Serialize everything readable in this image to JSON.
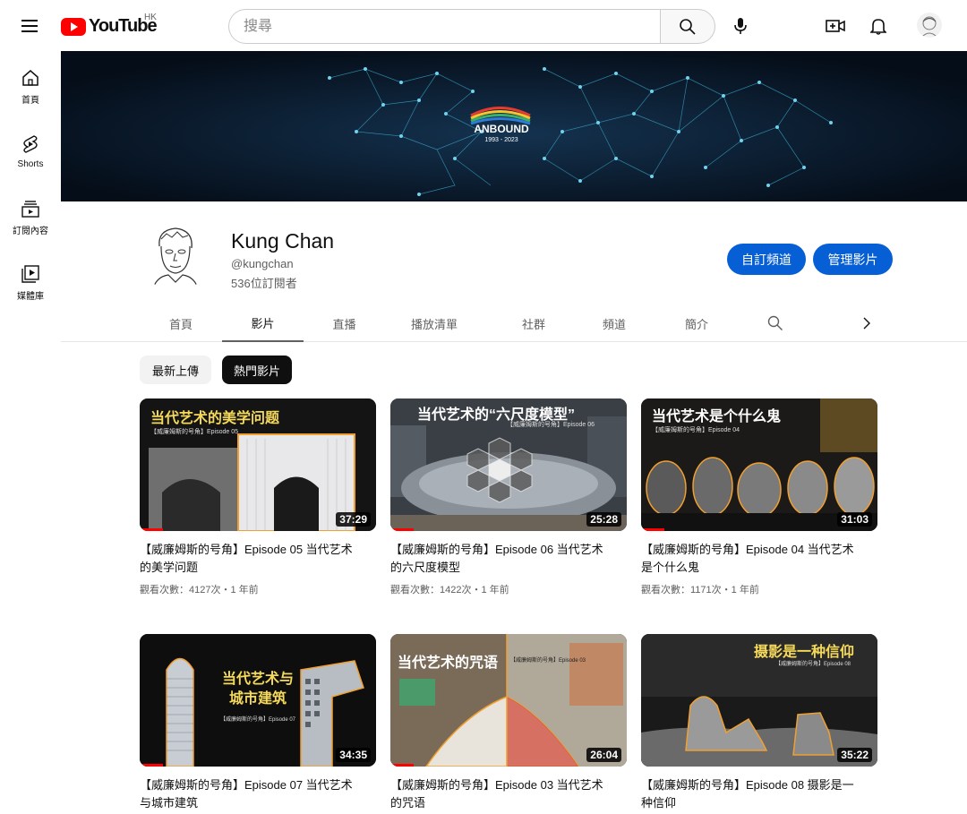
{
  "header": {
    "logo_text": "YouTube",
    "region": "HK",
    "search_placeholder": "搜尋"
  },
  "sidebar": {
    "items": [
      {
        "label": "首頁",
        "icon": "home-icon"
      },
      {
        "label": "Shorts",
        "icon": "shorts-icon"
      },
      {
        "label": "訂閱內容",
        "icon": "subscriptions-icon"
      },
      {
        "label": "媒體庫",
        "icon": "library-icon"
      }
    ]
  },
  "banner": {
    "logo_text": "ANBOUND",
    "years": "1993 - 2023"
  },
  "channel": {
    "name": "Kung Chan",
    "handle": "@kungchan",
    "subscribers": "536位訂閱者",
    "customize_label": "自訂頻道",
    "manage_label": "管理影片"
  },
  "tabs": [
    "首頁",
    "影片",
    "直播",
    "播放清單",
    "社群",
    "頻道",
    "簡介"
  ],
  "active_tab": "影片",
  "chips": [
    "最新上傳",
    "熱門影片"
  ],
  "active_chip": "熱門影片",
  "videos": [
    {
      "thumb_text": "当代艺术的美学问题",
      "thumb_sub": "【威廉姆斯的号角】Episode 05",
      "duration": "37:29",
      "title": "【威廉姆斯的号角】Episode 05 当代艺术的美学问题",
      "meta": "觀看次數：4127次・1 年前",
      "progress": 0.1
    },
    {
      "thumb_text": "当代艺术的“六尺度模型”",
      "thumb_sub": "【威廉姆斯的号角】Episode 06",
      "duration": "25:28",
      "title": "【威廉姆斯的号角】Episode 06 当代艺术的六尺度模型",
      "meta": "觀看次數：1422次・1 年前",
      "progress": 0.1
    },
    {
      "thumb_text": "当代艺术是个什么鬼",
      "thumb_sub": "【威廉姆斯的号角】Episode 04",
      "duration": "31:03",
      "title": "【威廉姆斯的号角】Episode 04 当代艺术是个什么鬼",
      "meta": "觀看次數：1171次・1 年前",
      "progress": 0.1
    },
    {
      "thumb_text": "当代艺术与城市建筑",
      "thumb_sub": "【威廉姆斯的号角】Episode 07",
      "duration": "34:35",
      "title": "【威廉姆斯的号角】Episode 07 当代艺术与城市建筑",
      "meta": "",
      "progress": 0.1
    },
    {
      "thumb_text": "当代艺术的咒语",
      "thumb_sub": "【威廉姆斯的号角】Episode 03",
      "duration": "26:04",
      "title": "【威廉姆斯的号角】Episode 03 当代艺术的咒语",
      "meta": "",
      "progress": 0.1
    },
    {
      "thumb_text": "摄影是一种信仰",
      "thumb_sub": "【威廉姆斯的号角】Episode 08",
      "duration": "35:22",
      "title": "【威廉姆斯的号角】Episode 08 摄影是一种信仰",
      "meta": "",
      "progress": 0.0
    }
  ],
  "colors": {
    "accent": "#065fd4",
    "brand_red": "#ff0000",
    "thumb_title_yellow": "#f5d95a"
  }
}
